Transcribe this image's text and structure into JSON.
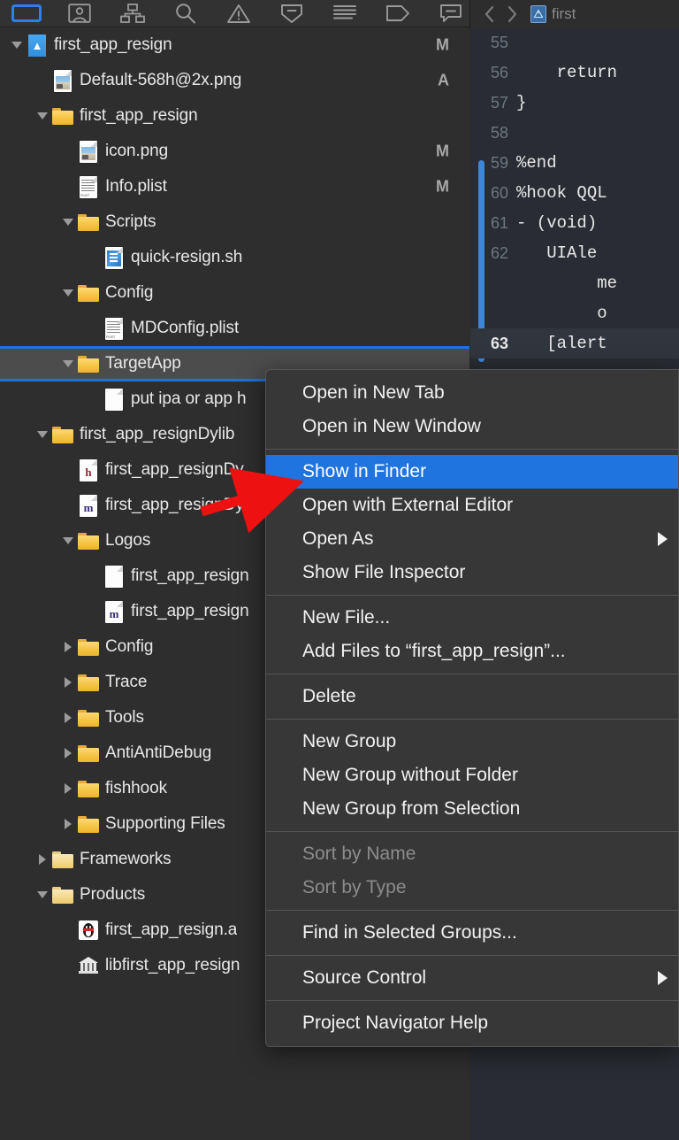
{
  "toolbar": {
    "navigator_icons": [
      {
        "name": "project-navigator-icon",
        "label": "Project Navigator",
        "selected": true
      },
      {
        "name": "source-control-navigator-icon",
        "label": "Source Control Navigator",
        "selected": false
      },
      {
        "name": "symbol-navigator-icon",
        "label": "Symbol Navigator",
        "selected": false
      },
      {
        "name": "find-navigator-icon",
        "label": "Find Navigator",
        "selected": false
      },
      {
        "name": "issue-navigator-icon",
        "label": "Issue Navigator",
        "selected": false
      },
      {
        "name": "test-navigator-icon",
        "label": "Test Navigator",
        "selected": false
      },
      {
        "name": "debug-navigator-icon",
        "label": "Debug Navigator",
        "selected": false
      },
      {
        "name": "breakpoint-navigator-icon",
        "label": "Breakpoint Navigator",
        "selected": false
      },
      {
        "name": "report-navigator-icon",
        "label": "Report Navigator",
        "selected": false
      }
    ],
    "back_label": "Back",
    "forward_label": "Forward",
    "breadcrumb_text": "first"
  },
  "navigator": {
    "rows": [
      {
        "label": "first_app_resign",
        "icon": "xcode-project-icon",
        "indent": 0,
        "twisty": "down",
        "status": "M"
      },
      {
        "label": "Default-568h@2x.png",
        "icon": "image-file-icon",
        "indent": 1,
        "twisty": "none",
        "status": "A"
      },
      {
        "label": "first_app_resign",
        "icon": "folder-icon",
        "indent": 1,
        "twisty": "down",
        "status": ""
      },
      {
        "label": "icon.png",
        "icon": "image-file-icon",
        "indent": 2,
        "twisty": "none",
        "status": "M"
      },
      {
        "label": "Info.plist",
        "icon": "plist-file-icon",
        "indent": 2,
        "twisty": "none",
        "status": "M"
      },
      {
        "label": "Scripts",
        "icon": "folder-icon",
        "indent": 2,
        "twisty": "down",
        "status": ""
      },
      {
        "label": "quick-resign.sh",
        "icon": "shell-script-icon",
        "indent": 3,
        "twisty": "none",
        "status": ""
      },
      {
        "label": "Config",
        "icon": "folder-icon",
        "indent": 2,
        "twisty": "down",
        "status": ""
      },
      {
        "label": "MDConfig.plist",
        "icon": "plist-file-icon",
        "indent": 3,
        "twisty": "none",
        "status": ""
      },
      {
        "label": "TargetApp",
        "icon": "folder-icon",
        "indent": 2,
        "twisty": "down",
        "status": "",
        "selected": true
      },
      {
        "label": "put ipa or app h",
        "icon": "blank-file-icon",
        "indent": 3,
        "twisty": "none",
        "status": ""
      },
      {
        "label": "first_app_resignDylib",
        "icon": "folder-icon",
        "indent": 1,
        "twisty": "down",
        "status": ""
      },
      {
        "label": "first_app_resignDy",
        "icon": "header-file-icon",
        "indent": 2,
        "twisty": "none",
        "status": ""
      },
      {
        "label": "first_app_resignDy",
        "icon": "objc-file-icon",
        "indent": 2,
        "twisty": "none",
        "status": ""
      },
      {
        "label": "Logos",
        "icon": "folder-icon",
        "indent": 2,
        "twisty": "down",
        "status": ""
      },
      {
        "label": "first_app_resign",
        "icon": "blank-file-icon",
        "indent": 3,
        "twisty": "none",
        "status": ""
      },
      {
        "label": "first_app_resign",
        "icon": "objc-file-icon",
        "indent": 3,
        "twisty": "none",
        "status": ""
      },
      {
        "label": "Config",
        "icon": "folder-icon",
        "indent": 2,
        "twisty": "right",
        "status": ""
      },
      {
        "label": "Trace",
        "icon": "folder-icon",
        "indent": 2,
        "twisty": "right",
        "status": ""
      },
      {
        "label": "Tools",
        "icon": "folder-icon",
        "indent": 2,
        "twisty": "right",
        "status": ""
      },
      {
        "label": "AntiAntiDebug",
        "icon": "folder-icon",
        "indent": 2,
        "twisty": "right",
        "status": ""
      },
      {
        "label": "fishhook",
        "icon": "folder-icon",
        "indent": 2,
        "twisty": "right",
        "status": ""
      },
      {
        "label": "Supporting Files",
        "icon": "folder-icon",
        "indent": 2,
        "twisty": "right",
        "status": ""
      },
      {
        "label": "Frameworks",
        "icon": "folder-pale-icon",
        "indent": 1,
        "twisty": "right",
        "status": ""
      },
      {
        "label": "Products",
        "icon": "folder-pale-icon",
        "indent": 1,
        "twisty": "down",
        "status": ""
      },
      {
        "label": "first_app_resign.a",
        "icon": "app-penguin-icon",
        "indent": 2,
        "twisty": "none",
        "status": ""
      },
      {
        "label": "libfirst_app_resign",
        "icon": "library-icon",
        "indent": 2,
        "twisty": "none",
        "status": ""
      }
    ]
  },
  "editor": {
    "lines": [
      {
        "num": "55",
        "text": "",
        "current": false,
        "changed": false
      },
      {
        "num": "56",
        "text": "    return",
        "current": false,
        "changed": false
      },
      {
        "num": "57",
        "text": "}",
        "current": false,
        "changed": false
      },
      {
        "num": "58",
        "text": "",
        "current": false,
        "changed": false
      },
      {
        "num": "59",
        "text": "%end",
        "current": false,
        "changed": false
      },
      {
        "num": "60",
        "text": "%hook QQL",
        "current": false,
        "changed": true
      },
      {
        "num": "61",
        "text": "- (void) ",
        "current": false,
        "changed": true
      },
      {
        "num": "62",
        "text": "   UIAle",
        "current": false,
        "changed": true
      },
      {
        "num": "",
        "text": "        me",
        "current": false,
        "changed": true
      },
      {
        "num": "",
        "text": "        o",
        "current": false,
        "changed": true
      },
      {
        "num": "63",
        "text": "   [alert",
        "current": true,
        "changed": true
      }
    ]
  },
  "context_menu": {
    "groups": [
      {
        "items": [
          {
            "label": "Open in New Tab",
            "state": "normal",
            "submenu": false
          },
          {
            "label": "Open in New Window",
            "state": "normal",
            "submenu": false
          }
        ]
      },
      {
        "items": [
          {
            "label": "Show in Finder",
            "state": "highlighted",
            "submenu": false
          },
          {
            "label": "Open with External Editor",
            "state": "normal",
            "submenu": false
          },
          {
            "label": "Open As",
            "state": "normal",
            "submenu": true
          },
          {
            "label": "Show File Inspector",
            "state": "normal",
            "submenu": false
          }
        ]
      },
      {
        "items": [
          {
            "label": "New File...",
            "state": "normal",
            "submenu": false
          },
          {
            "label": "Add Files to “first_app_resign”...",
            "state": "normal",
            "submenu": false
          }
        ]
      },
      {
        "items": [
          {
            "label": "Delete",
            "state": "normal",
            "submenu": false
          }
        ]
      },
      {
        "items": [
          {
            "label": "New Group",
            "state": "normal",
            "submenu": false
          },
          {
            "label": "New Group without Folder",
            "state": "normal",
            "submenu": false
          },
          {
            "label": "New Group from Selection",
            "state": "normal",
            "submenu": false
          }
        ]
      },
      {
        "items": [
          {
            "label": "Sort by Name",
            "state": "disabled",
            "submenu": false
          },
          {
            "label": "Sort by Type",
            "state": "disabled",
            "submenu": false
          }
        ]
      },
      {
        "items": [
          {
            "label": "Find in Selected Groups...",
            "state": "normal",
            "submenu": false
          }
        ]
      },
      {
        "items": [
          {
            "label": "Source Control",
            "state": "normal",
            "submenu": true
          }
        ]
      },
      {
        "items": [
          {
            "label": "Project Navigator Help",
            "state": "normal",
            "submenu": false
          }
        ]
      }
    ]
  },
  "annotation": {
    "type": "red-arrow",
    "color": "#ee1111",
    "points_to": "Show in Finder"
  },
  "colors": {
    "selection_blue": "#1f6feb",
    "menu_highlight": "#1f74e0",
    "navigator_bg": "#2e2e2e",
    "editor_bg": "#292d33",
    "menu_bg": "#373737",
    "folder_yellow": "#f5c344",
    "annotation_red": "#ee1111"
  }
}
